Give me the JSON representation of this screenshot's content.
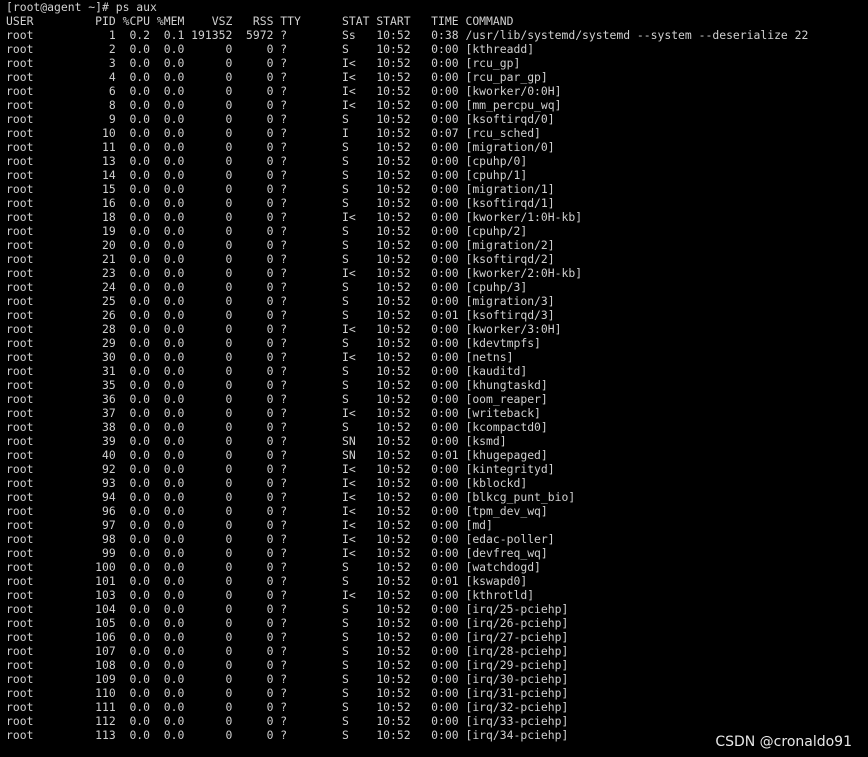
{
  "terminal": {
    "prompt": "[root@agent ~]# ps aux",
    "header": "USER         PID %CPU %MEM    VSZ   RSS TTY      STAT START   TIME COMMAND",
    "rows": [
      "root           1  0.2  0.1 191352  5972 ?        Ss   10:52   0:38 /usr/lib/systemd/systemd --system --deserialize 22",
      "root           2  0.0  0.0      0     0 ?        S    10:52   0:00 [kthreadd]",
      "root           3  0.0  0.0      0     0 ?        I<   10:52   0:00 [rcu_gp]",
      "root           4  0.0  0.0      0     0 ?        I<   10:52   0:00 [rcu_par_gp]",
      "root           6  0.0  0.0      0     0 ?        I<   10:52   0:00 [kworker/0:0H]",
      "root           8  0.0  0.0      0     0 ?        I<   10:52   0:00 [mm_percpu_wq]",
      "root           9  0.0  0.0      0     0 ?        S    10:52   0:00 [ksoftirqd/0]",
      "root          10  0.0  0.0      0     0 ?        I    10:52   0:07 [rcu_sched]",
      "root          11  0.0  0.0      0     0 ?        S    10:52   0:00 [migration/0]",
      "root          13  0.0  0.0      0     0 ?        S    10:52   0:00 [cpuhp/0]",
      "root          14  0.0  0.0      0     0 ?        S    10:52   0:00 [cpuhp/1]",
      "root          15  0.0  0.0      0     0 ?        S    10:52   0:00 [migration/1]",
      "root          16  0.0  0.0      0     0 ?        S    10:52   0:00 [ksoftirqd/1]",
      "root          18  0.0  0.0      0     0 ?        I<   10:52   0:00 [kworker/1:0H-kb]",
      "root          19  0.0  0.0      0     0 ?        S    10:52   0:00 [cpuhp/2]",
      "root          20  0.0  0.0      0     0 ?        S    10:52   0:00 [migration/2]",
      "root          21  0.0  0.0      0     0 ?        S    10:52   0:00 [ksoftirqd/2]",
      "root          23  0.0  0.0      0     0 ?        I<   10:52   0:00 [kworker/2:0H-kb]",
      "root          24  0.0  0.0      0     0 ?        S    10:52   0:00 [cpuhp/3]",
      "root          25  0.0  0.0      0     0 ?        S    10:52   0:00 [migration/3]",
      "root          26  0.0  0.0      0     0 ?        S    10:52   0:01 [ksoftirqd/3]",
      "root          28  0.0  0.0      0     0 ?        I<   10:52   0:00 [kworker/3:0H]",
      "root          29  0.0  0.0      0     0 ?        S    10:52   0:00 [kdevtmpfs]",
      "root          30  0.0  0.0      0     0 ?        I<   10:52   0:00 [netns]",
      "root          31  0.0  0.0      0     0 ?        S    10:52   0:00 [kauditd]",
      "root          35  0.0  0.0      0     0 ?        S    10:52   0:00 [khungtaskd]",
      "root          36  0.0  0.0      0     0 ?        S    10:52   0:00 [oom_reaper]",
      "root          37  0.0  0.0      0     0 ?        I<   10:52   0:00 [writeback]",
      "root          38  0.0  0.0      0     0 ?        S    10:52   0:00 [kcompactd0]",
      "root          39  0.0  0.0      0     0 ?        SN   10:52   0:00 [ksmd]",
      "root          40  0.0  0.0      0     0 ?        SN   10:52   0:01 [khugepaged]",
      "root          92  0.0  0.0      0     0 ?        I<   10:52   0:00 [kintegrityd]",
      "root          93  0.0  0.0      0     0 ?        I<   10:52   0:00 [kblockd]",
      "root          94  0.0  0.0      0     0 ?        I<   10:52   0:00 [blkcg_punt_bio]",
      "root          96  0.0  0.0      0     0 ?        I<   10:52   0:00 [tpm_dev_wq]",
      "root          97  0.0  0.0      0     0 ?        I<   10:52   0:00 [md]",
      "root          98  0.0  0.0      0     0 ?        I<   10:52   0:00 [edac-poller]",
      "root          99  0.0  0.0      0     0 ?        I<   10:52   0:00 [devfreq_wq]",
      "root         100  0.0  0.0      0     0 ?        S    10:52   0:00 [watchdogd]",
      "root         101  0.0  0.0      0     0 ?        S    10:52   0:01 [kswapd0]",
      "root         103  0.0  0.0      0     0 ?        I<   10:52   0:00 [kthrotld]",
      "root         104  0.0  0.0      0     0 ?        S    10:52   0:00 [irq/25-pciehp]",
      "root         105  0.0  0.0      0     0 ?        S    10:52   0:00 [irq/26-pciehp]",
      "root         106  0.0  0.0      0     0 ?        S    10:52   0:00 [irq/27-pciehp]",
      "root         107  0.0  0.0      0     0 ?        S    10:52   0:00 [irq/28-pciehp]",
      "root         108  0.0  0.0      0     0 ?        S    10:52   0:00 [irq/29-pciehp]",
      "root         109  0.0  0.0      0     0 ?        S    10:52   0:00 [irq/30-pciehp]",
      "root         110  0.0  0.0      0     0 ?        S    10:52   0:00 [irq/31-pciehp]",
      "root         111  0.0  0.0      0     0 ?        S    10:52   0:00 [irq/32-pciehp]",
      "root         112  0.0  0.0      0     0 ?        S    10:52   0:00 [irq/33-pciehp]",
      "root         113  0.0  0.0      0     0 ?        S    10:52   0:00 [irq/34-pciehp]"
    ]
  },
  "watermark": "CSDN @cronaldo91",
  "colors": {
    "background": "#000000",
    "text": "#d0d0d0",
    "watermark": "#e8e8e8"
  }
}
